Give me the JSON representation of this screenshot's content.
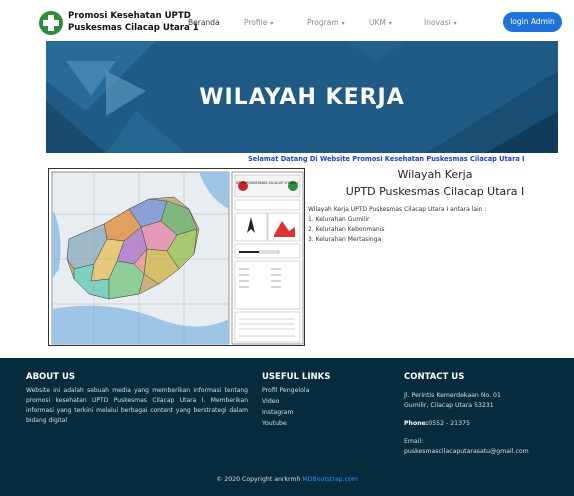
{
  "brand": {
    "line1": "Promosi Kesehatan UPTD",
    "line2": "Puskesmas Cilacap Utara 1"
  },
  "nav": {
    "items": [
      {
        "label": "Beranda",
        "caret": ""
      },
      {
        "label": "Profile",
        "caret": "▾"
      },
      {
        "label": "Program",
        "caret": "▾"
      },
      {
        "label": "UKM",
        "caret": "▾"
      },
      {
        "label": "Inovasi",
        "caret": "▾"
      }
    ],
    "login_label": "login Admin"
  },
  "colors": {
    "accent": "#1e73d8",
    "hero": "#1f5b85",
    "footer": "#062b3d",
    "welcome": "#1e3fbf"
  },
  "hero": {
    "title": "WILAYAH KERJA"
  },
  "welcome": "Selamat Datang Di Website Promosi Kesehatan Puskesmas Cilacap Utara I",
  "main": {
    "title1": "Wilayah Kerja",
    "title2": "UPTD Puskesmas Cilacap Utara I",
    "intro": "Wilayah Kerja UPTD Puskesmas Cilacap Utara I antara lain :",
    "areas": [
      "1. Kelurahan Gumilir",
      "2. Kelurahan Kebonmanis",
      "3. Kelurahan Mertasinga"
    ],
    "map_header": "UPTD PUSKESMAS CILACAP UTARA I"
  },
  "footer": {
    "about_heading": "ABOUT US",
    "about_text": "Website ini adalah sebuah media yang memberikan informasi tentang promosi kesehatan UPTD Puskesmas Cilacap Utara I. Memberikan informasi yang terkini melalui berbagai content yang berstrategi dalam bidang digital",
    "links_heading": "USEFUL LINKS",
    "links": [
      "Profil Pengelola",
      "Video",
      "Instagram",
      "Youtube"
    ],
    "contact_heading": "CONTACT US",
    "address1": "Jl. Perintis Kemerdekaan No. 01",
    "address2": "Gumilir, Cilacap Utara 53231",
    "phone_label": "Phone:",
    "phone": "0552 - 21375",
    "email_label": "Email:",
    "email": "puskesmascilacaputarasatu@gmail.com",
    "copyright": "© 2020 Copyright anrkrmh",
    "copyright_link": "MDBootstrap.com"
  }
}
